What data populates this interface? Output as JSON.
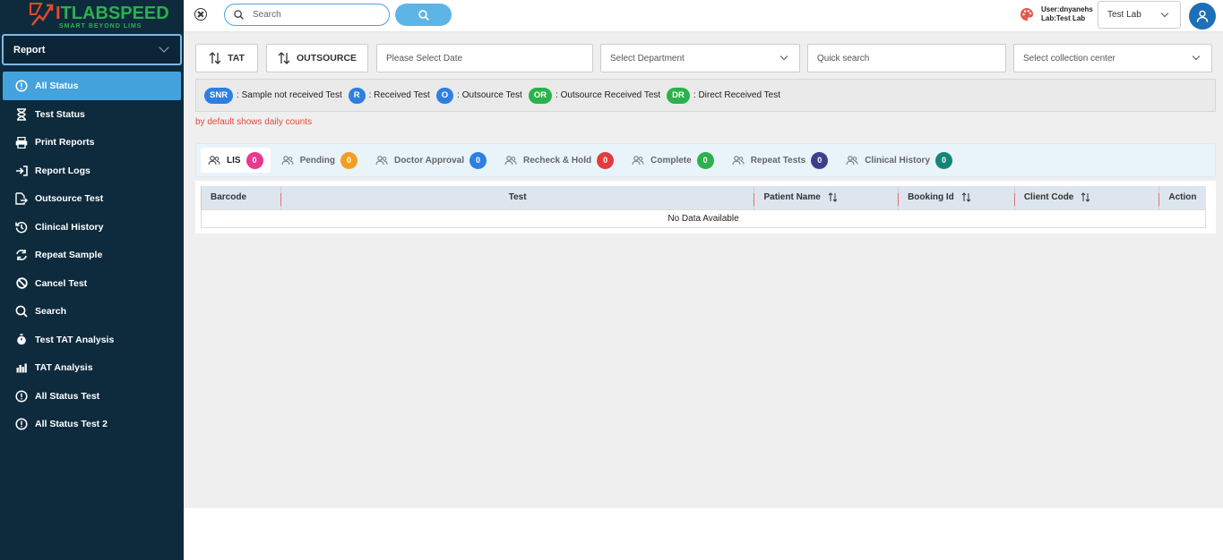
{
  "brand": {
    "logo_letter": "I",
    "logo_rest": "TLABSPEED",
    "tagline": "SMART BEYOND LIMS",
    "accent_green": "#2bb24c",
    "accent_red": "#e24a2b"
  },
  "sidebar": {
    "report_select": "Report",
    "items": [
      {
        "label": "All Status",
        "icon": "alert-circle-icon",
        "active": true
      },
      {
        "label": "Test Status",
        "icon": "hourglass-icon"
      },
      {
        "label": "Print Reports",
        "icon": "printer-icon"
      },
      {
        "label": "Report Logs",
        "icon": "sign-in-icon"
      },
      {
        "label": "Outsource Test",
        "icon": "file-export-icon"
      },
      {
        "label": "Clinical History",
        "icon": "history-icon"
      },
      {
        "label": "Repeat Sample",
        "icon": "refresh-icon"
      },
      {
        "label": "Cancel Test",
        "icon": "ban-icon"
      },
      {
        "label": "Search",
        "icon": "search-icon"
      },
      {
        "label": "Test TAT Analysis",
        "icon": "stopwatch-icon"
      },
      {
        "label": "TAT Analysis",
        "icon": "bar-chart-icon"
      },
      {
        "label": "All Status Test",
        "icon": "alert-circle-icon"
      },
      {
        "label": "All Status Test 2",
        "icon": "alert-circle-icon"
      }
    ]
  },
  "topbar": {
    "search_placeholder": "Search",
    "user_line": "User:dnyanehs",
    "lab_line": "Lab:Test Lab",
    "lab_select": "Test Lab"
  },
  "filters": {
    "tat_label": "TAT",
    "outsource_label": "OUTSOURCE",
    "date_placeholder": "Please Select Date",
    "department_placeholder": "Select Department",
    "quick_search_placeholder": "Quick search",
    "collection_center_placeholder": "Select collection center"
  },
  "legend": [
    {
      "code": "SNR",
      "text": ": Sample not received Test",
      "color": "#2e7fe0"
    },
    {
      "code": "R",
      "text": ": Received Test",
      "color": "#2e7fe0"
    },
    {
      "code": "O",
      "text": ": Outsource Test",
      "color": "#2e7fe0"
    },
    {
      "code": "OR",
      "text": ": Outsource Received Test",
      "color": "#2bb24c"
    },
    {
      "code": "DR",
      "text": ": Direct Received Test",
      "color": "#2bb24c"
    }
  ],
  "note": "by default shows daily counts",
  "tabs": [
    {
      "label": "LIS",
      "count": "0",
      "color": "#e8388f",
      "active": true
    },
    {
      "label": "Pending",
      "count": "0",
      "color": "#f0a020"
    },
    {
      "label": "Doctor Approval",
      "count": "0",
      "color": "#2e7fe0"
    },
    {
      "label": "Recheck & Hold",
      "count": "0",
      "color": "#e23b3b"
    },
    {
      "label": "Complete",
      "count": "0",
      "color": "#2bb24c"
    },
    {
      "label": "Repeat Tests",
      "count": "0",
      "color": "#3c3f8f"
    },
    {
      "label": "Clinical History",
      "count": "0",
      "color": "#138577"
    }
  ],
  "table": {
    "columns": [
      "Barcode",
      "Test",
      "Patient Name",
      "Booking Id",
      "Client Code",
      "Action"
    ],
    "empty_text": "No Data Available"
  }
}
